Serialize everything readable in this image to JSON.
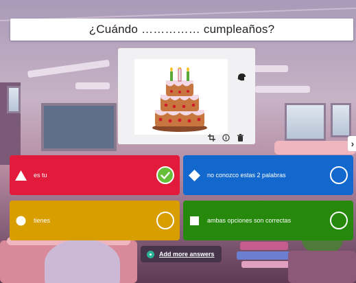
{
  "question": {
    "text": "¿Cuándo …………… cumpleaños?"
  },
  "media": {
    "image_icon": "birthday-cake",
    "tools": [
      "crop-icon",
      "info-icon",
      "trash-icon"
    ]
  },
  "navigation": {
    "next_symbol": "›"
  },
  "answers": [
    {
      "text": "es tu",
      "shape": "triangle",
      "color": "#e21b3c",
      "correct": true
    },
    {
      "text": "no conozco estas 2 palabras",
      "shape": "diamond",
      "color": "#1368ce",
      "correct": false
    },
    {
      "text": "tienes",
      "shape": "circle",
      "color": "#d89e00",
      "correct": false
    },
    {
      "text": "ambas opciones son correctas",
      "shape": "square",
      "color": "#26890c",
      "correct": false
    }
  ],
  "add_more": {
    "label": "Add more answers",
    "accent": "#2bb39a"
  }
}
